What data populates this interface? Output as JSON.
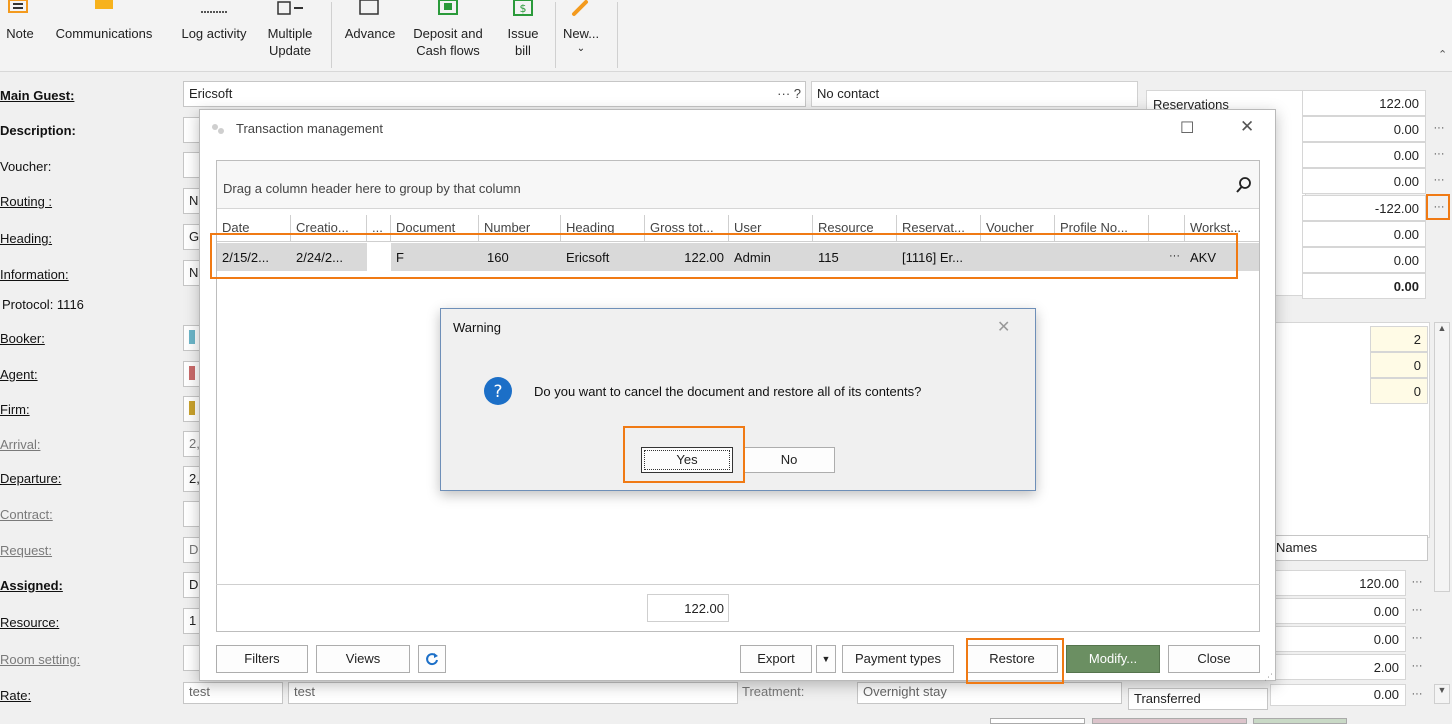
{
  "ribbon": {
    "note": "Note",
    "communications": "Communications",
    "log_activity": "Log activity",
    "multiple_update_1": "Multiple",
    "multiple_update_2": "Update",
    "advance": "Advance",
    "deposit_1": "Deposit and",
    "deposit_2": "Cash flows",
    "issue_1": "Issue",
    "issue_2": "bill",
    "new": "New..."
  },
  "form": {
    "labels": [
      "Main Guest:",
      "Description:",
      "Voucher:",
      "Routing :",
      "Heading:",
      "Information:",
      "Protocol: 1116",
      "Booker:",
      "Agent:",
      "Firm:",
      "Arrival:",
      "Departure:",
      "Contract:",
      "Request:",
      "Assigned:",
      "Resource:",
      "Room setting:",
      "Rate:"
    ],
    "main_guest_value": "Ericsoft",
    "main_guest_suffix": "··· ?",
    "contact": "No contact",
    "partial_left": [
      "N",
      "G",
      "N",
      "2,",
      "2,",
      "D",
      "D",
      "1"
    ],
    "rate_value": "test",
    "rate_value2": "test",
    "treatment_label": "Treatment:",
    "treatment_value": "Overnight stay"
  },
  "right_panel": {
    "reservations_label": "Reservations",
    "values": [
      "122.00",
      "0.00",
      "0.00",
      "0.00",
      "-122.00",
      "0.00",
      "0.00",
      "0.00"
    ],
    "counts": [
      "2",
      "0",
      "0"
    ],
    "names_label": "Names",
    "values2": [
      "120.00",
      "0.00",
      "0.00",
      "2.00",
      "0.00"
    ],
    "transferred_label": "Transferred"
  },
  "transaction_dialog": {
    "title": "Transaction management",
    "group_hint": "Drag a column header here to group by that column",
    "columns": [
      "Date",
      "Creatio...",
      "...",
      "Document",
      "Number",
      "Heading",
      "Gross tot...",
      "User",
      "Resource",
      "Reservat...",
      "Voucher",
      "Profile No...",
      "",
      "Workst..."
    ],
    "row": {
      "date": "2/15/2...",
      "creation": "2/24/2...",
      "document": "F",
      "number": "160",
      "heading": "Ericsoft",
      "gross": "122.00",
      "user": "Admin",
      "resource": "115",
      "reservation": "[1116] Er...",
      "dots": "···",
      "workstation": "AKV"
    },
    "total": "122.00",
    "buttons": {
      "filters": "Filters",
      "views": "Views",
      "export": "Export",
      "payment_types": "Payment types",
      "restore": "Restore",
      "modify": "Modify...",
      "close": "Close"
    }
  },
  "warning_dialog": {
    "title": "Warning",
    "message": "Do you want to cancel the document and restore all of its contents?",
    "yes": "Yes",
    "no": "No"
  },
  "colors": {
    "accent_orange": "#f07a14",
    "modify_green": "#6b8f62",
    "info_blue": "#1c6fc7",
    "selected_row": "#d9d9d9"
  }
}
